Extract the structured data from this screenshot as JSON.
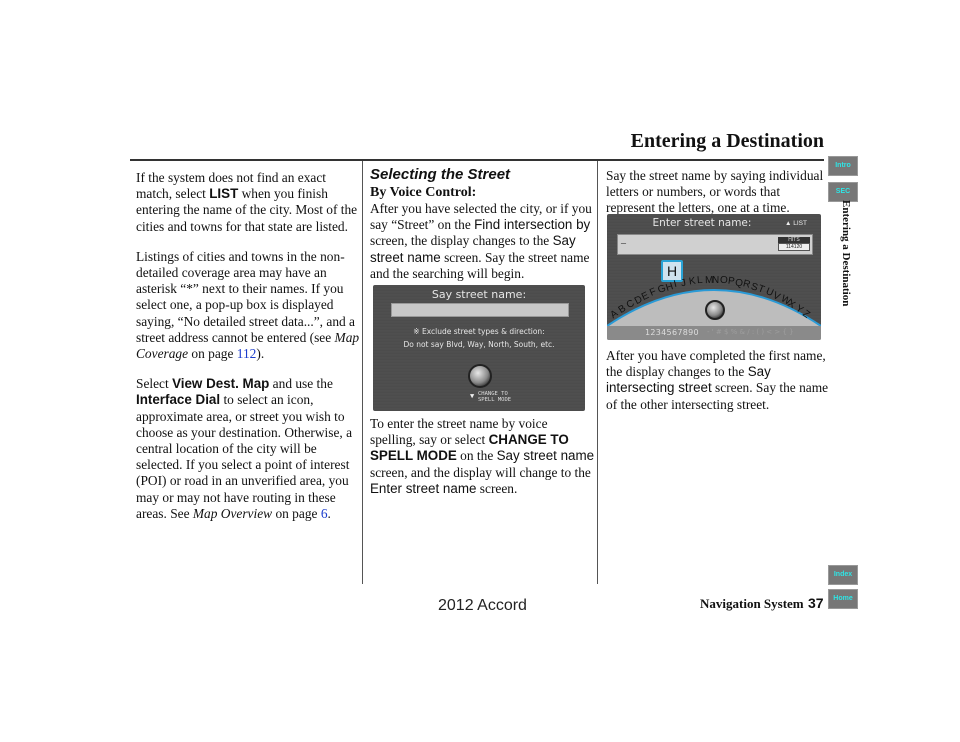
{
  "header": {
    "title": "Entering a Destination",
    "side_title": "Entering a Destination"
  },
  "side_nav": {
    "intro": "Intro",
    "sec": "SEC",
    "index": "Index",
    "home": "Home"
  },
  "col1": {
    "p1_a": "If the system does not find an exact match, select ",
    "p1_b": "LIST",
    "p1_c": " when you finish entering the name of the city. Most of the cities and towns for that state are listed.",
    "p2_a": "Listings of cities and towns in the non-detailed coverage area may have an asterisk “*” next to their names. If you select one, a pop-up box is displayed saying, “No detailed street data...”, and a street address cannot be entered (see ",
    "p2_link_text": "Map Coverage",
    "p2_b": " on page ",
    "p2_page": "112",
    "p2_c": ").",
    "p3_a": "Select ",
    "p3_b": "View Dest. Map",
    "p3_c": " and use the ",
    "p3_d": "Interface Dial",
    "p3_e": " to select an icon, approximate area, or street you wish to choose as your destination. Otherwise, a central location of the city will be selected. If you select a point of interest (POI) or road in an unverified area, you may or may not have routing in these areas. See ",
    "p3_link_text": "Map Overview",
    "p3_f": " on page ",
    "p3_page": "6",
    "p3_g": "."
  },
  "col2": {
    "heading": "Selecting the Street",
    "subheading": "By Voice Control:",
    "p1_a": "After you have selected the city, or if you say “Street” on the ",
    "p1_b": "Find intersection by",
    "p1_c": " screen, the display changes to the ",
    "p1_d": "Say street name",
    "p1_e": " screen. Say the street name and the searching will begin.",
    "screen": {
      "title": "Say street name:",
      "note1": "※ Exclude street types & direction:",
      "note2": "Do not say Blvd, Way, North, South, etc.",
      "change1": "CHANGE TO",
      "change2": "SPELL MODE"
    },
    "p2_a": "To enter the street name by voice spelling, say or select ",
    "p2_b": "CHANGE TO SPELL MODE",
    "p2_c": " on the ",
    "p2_d": "Say street name",
    "p2_e": " screen, and the display will change to the ",
    "p2_f": "Enter street name",
    "p2_g": " screen."
  },
  "col3": {
    "p1": "Say the street name by saying individual letters or numbers, or words that represent the letters, one at a time.",
    "screen": {
      "title": "Enter street name:",
      "list": "LIST",
      "input_value": "–",
      "hits_label": "HITS",
      "hits_value": "114120",
      "selected_letter": "H",
      "alphabet": "ABCDEFGHIJKLMNOPQRSTUVWXYZ",
      "numbers": "1234567890",
      "symbols": "- ' # $ % & / : ( ) < > { }"
    },
    "p2_a": "After you have completed the first name, the display changes to the ",
    "p2_b": "Say intersecting street",
    "p2_c": " screen. Say the name of the other intersecting street."
  },
  "footer": {
    "system": "Navigation System",
    "page": "37",
    "watermark": "2012 Accord"
  }
}
